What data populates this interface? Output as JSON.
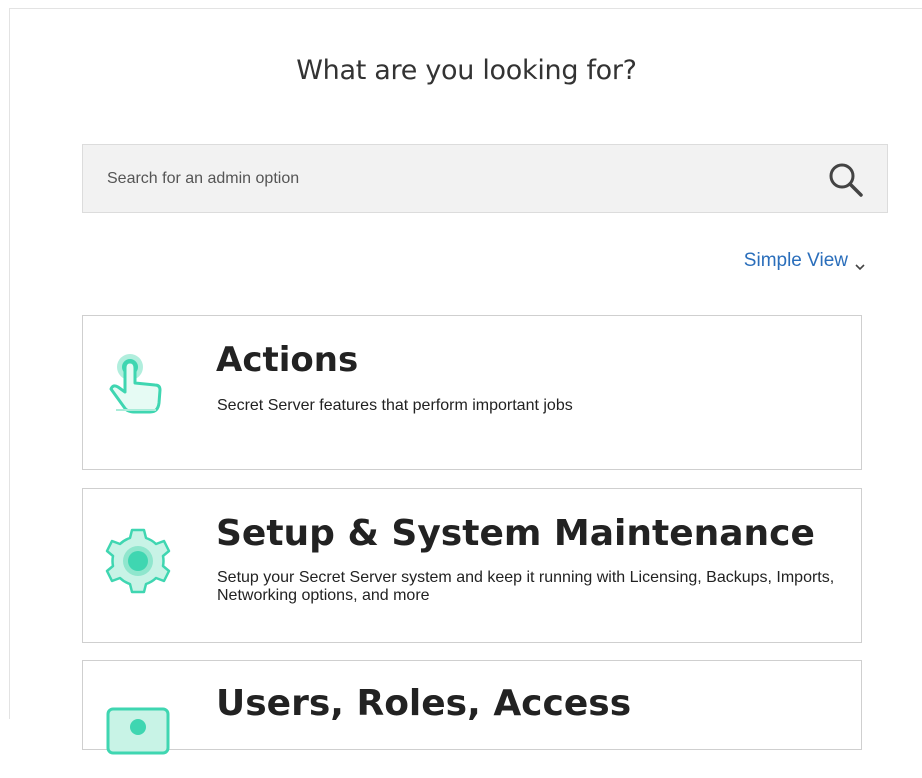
{
  "page": {
    "heading": "What are you looking for?"
  },
  "search": {
    "placeholder": "Search for an admin option",
    "value": ""
  },
  "view_toggle": {
    "label": "Simple View"
  },
  "cards": [
    {
      "title": "Actions",
      "description": "Secret Server features that perform important jobs",
      "icon": "hand-pointer-icon"
    },
    {
      "title": "Setup & System Maintenance",
      "description": "Setup your Secret Server system and keep it running with Licensing, Backups, Imports, Networking options, and more",
      "icon": "gear-icon"
    },
    {
      "title": "Users, Roles, Access",
      "description": "",
      "icon": "monitor-user-icon"
    }
  ],
  "colors": {
    "accent_teal": "#3fd6b1",
    "accent_teal_light": "#a9ecd9",
    "link_blue": "#2a6ebb",
    "search_bg": "#f2f2f2"
  }
}
